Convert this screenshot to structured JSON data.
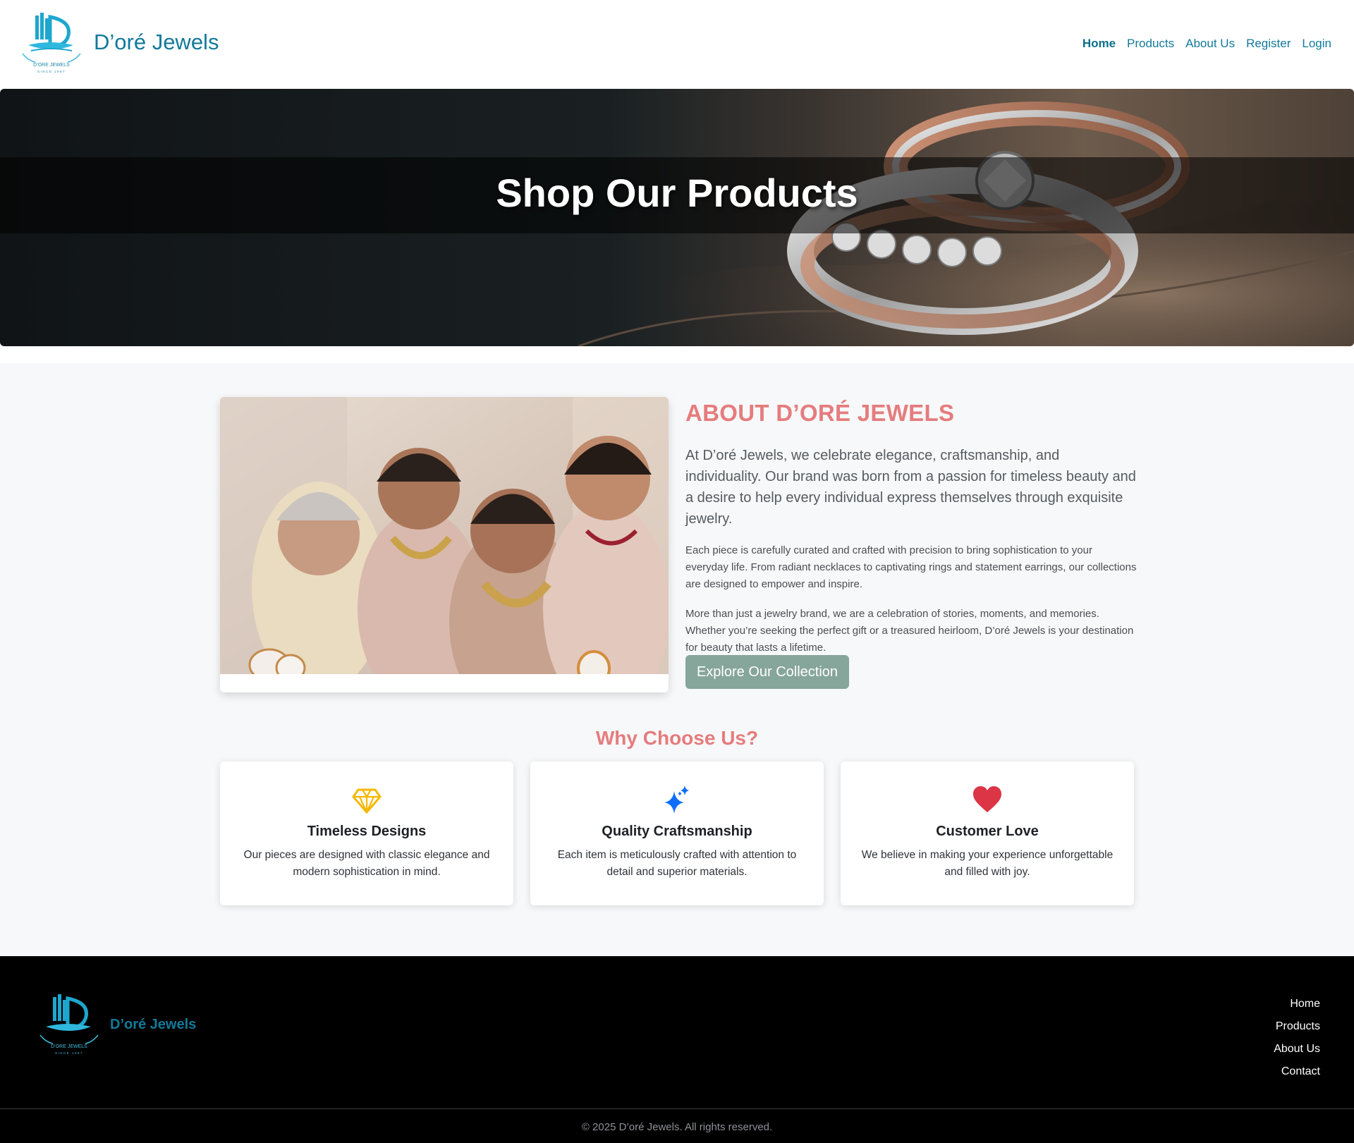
{
  "brand": {
    "name": "D’oré Jewels",
    "logo_caption": "D’ORE JEWELS",
    "logo_tagline": "SINCE 1997",
    "color": "#12799a"
  },
  "nav": {
    "items": [
      {
        "label": "Home",
        "active": true
      },
      {
        "label": "Products",
        "active": false
      },
      {
        "label": "About Us",
        "active": false
      },
      {
        "label": "Register",
        "active": false
      },
      {
        "label": "Login",
        "active": false
      }
    ]
  },
  "hero": {
    "title": "Shop Our Products"
  },
  "about": {
    "heading": "ABOUT D’ORÉ JEWELS",
    "lead": "At D’oré Jewels, we celebrate elegance, craftsmanship, and individuality. Our brand was born from a passion for timeless beauty and a desire to help every individual express themselves through exquisite jewelry.",
    "paragraph1": "Each piece is carefully curated and crafted with precision to bring sophistication to your everyday life. From radiant necklaces to captivating rings and statement earrings, our collections are designed to empower and inspire.",
    "paragraph2": "More than just a jewelry brand, we are a celebration of stories, moments, and memories. Whether you’re seeking the perfect gift or a treasured heirloom, D’oré Jewels is your destination for beauty that lasts a lifetime.",
    "button_label": "Explore Our Collection",
    "heading_color": "#e57c7e",
    "button_color": "#86a59b"
  },
  "why": {
    "heading": "Why Choose Us?",
    "features": [
      {
        "icon": "gem-icon",
        "title": "Timeless Designs",
        "description": "Our pieces are designed with classic elegance and modern sophistication in mind.",
        "icon_color": "#f5b800"
      },
      {
        "icon": "sparkles-icon",
        "title": "Quality Craftsmanship",
        "description": "Each item is meticulously crafted with attention to detail and superior materials.",
        "icon_color": "#0d6efd"
      },
      {
        "icon": "heart-icon",
        "title": "Customer Love",
        "description": "We believe in making your experience unforgettable and filled with joy.",
        "icon_color": "#dc3545"
      }
    ]
  },
  "footer": {
    "brand": "D’oré Jewels",
    "links": [
      "Home",
      "Products",
      "About Us",
      "Contact"
    ],
    "copyright": "© 2025 D’oré Jewels. All rights reserved."
  }
}
